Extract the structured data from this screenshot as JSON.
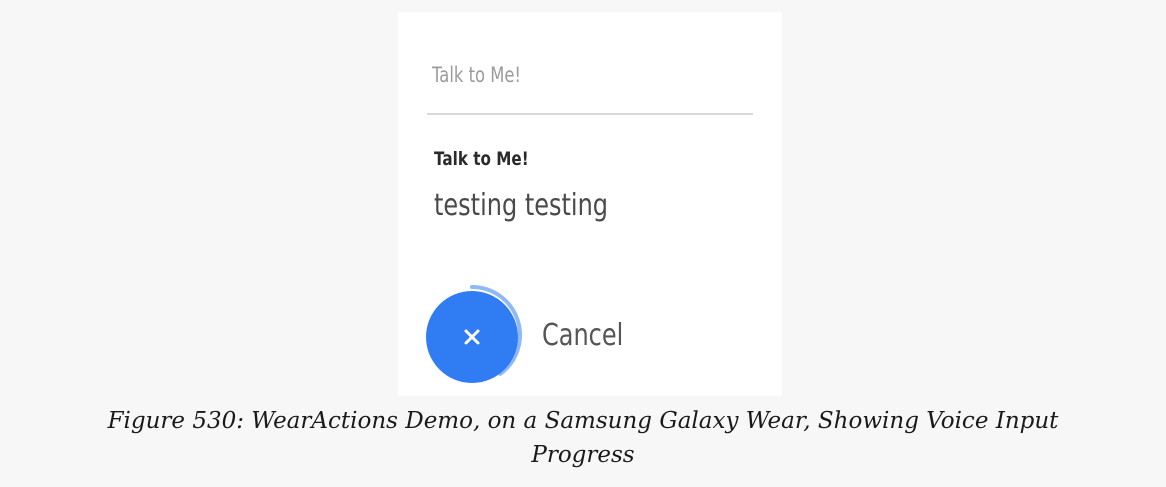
{
  "watch": {
    "header_title": "Talk to Me!",
    "field_label": "Talk to Me!",
    "transcribed_text": "testing testing",
    "cancel_label": "Cancel",
    "cancel_icon": "close-icon",
    "accent_color": "#2f7cf3",
    "progress_fraction": 0.4
  },
  "caption": {
    "line1": "Figure 530: WearActions Demo, on a Samsung Galaxy Wear, Showing Voice Input",
    "line2": "Progress"
  }
}
